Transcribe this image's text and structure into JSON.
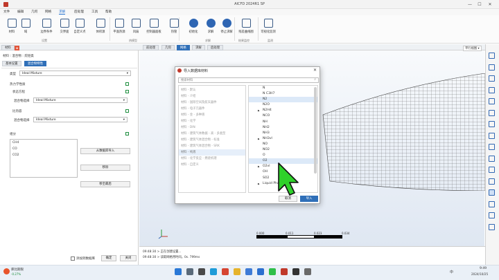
{
  "window": {
    "title": "AICFD 2024R1 SP",
    "min": "—",
    "max": "☐",
    "close": "✕"
  },
  "menu": [
    "文件",
    "编辑",
    "几何",
    "网格",
    "求解",
    "后处理",
    "工具",
    "帮助"
  ],
  "menu_active_index": 4,
  "ribbon": {
    "buttons": [
      {
        "label": "材料",
        "icon": "materials-icon"
      },
      {
        "label": "域",
        "icon": "domain-icon"
      },
      {
        "label": "边界条件",
        "icon": "boundary-icon"
      },
      {
        "label": "交界面",
        "icon": "interface-icon"
      },
      {
        "label": "自定义点",
        "icon": "more-icon"
      },
      {
        "label": "体积源",
        "icon": "volume-source-icon"
      },
      {
        "label": "平面热源",
        "icon": "plane-heat-icon"
      },
      {
        "label": "风扇",
        "icon": "fan-icon"
      },
      {
        "label": "控制器面板",
        "icon": "controller-icon"
      },
      {
        "label": "热管",
        "icon": "heat-pipe-icon"
      },
      {
        "label": "初始化",
        "icon": "init-icon"
      },
      {
        "label": "求解",
        "icon": "solve-icon"
      },
      {
        "label": "停止求解",
        "icon": "stop-icon"
      },
      {
        "label": "残差曲线图",
        "icon": "residual-icon"
      },
      {
        "label": "可视化监测",
        "icon": "monitor-icon"
      }
    ],
    "groups": [
      "设置",
      "热模型",
      "求解",
      "结果监控",
      "监测"
    ]
  },
  "tabs": [
    "前处理",
    "几何",
    "网格",
    "求解",
    "后处理"
  ],
  "active_tab_index": 3,
  "left_panel": {
    "panel_tabs": [
      "材料",
      "⊠"
    ],
    "breadcrumb": "材料 : 混合物 : 烷烃类",
    "sub_tabs": [
      "基本设置",
      "混合物特性"
    ],
    "active_sub_tab": 1,
    "type_label": "类型",
    "type_value": "Ideal Mixture",
    "thermo_section": "热力学性质",
    "state_eq_label": "状态方程",
    "mix_select_label": "混合物选择",
    "state_eq_value": "Ideal Mixture",
    "specific_heat_label": "比热容",
    "specific_heat_value": "Ideal Mixture",
    "components_label": "组分",
    "components": [
      "CH4",
      "CO",
      "CO2"
    ],
    "btn_import_db": "从数据库导入",
    "btn_remove": "移除",
    "btn_move_last": "移至最后",
    "checkbox_label": "添加到数据库",
    "btn_confirm": "确定",
    "btn_close": "关闭"
  },
  "dialog": {
    "title": "导入数据库材料",
    "search_placeholder": "搜索材料",
    "categories": [
      "材料 - 默认",
      "材料 - 介绍",
      "材料 - 国际空间及航天器件",
      "材料 - 电子元器件",
      "材料 - 金 - 多种液",
      "材料 - 化学",
      "材料 - DIN",
      "材料 - 建筑气体数据 - 高 - 多类型",
      "材料 - 建筑气体混合物 - 标准",
      "材料 - 建筑气体混合物 - SRK",
      "材料 - 纯液",
      "材料 - 化学反应 - 燃烧机理",
      "材料 - 自定义"
    ],
    "selected_category_index": 10,
    "materials": [
      {
        "name": "N",
        "arrow": false
      },
      {
        "name": "N C3H7",
        "arrow": false
      },
      {
        "name": "N2",
        "arrow": false,
        "sel": true
      },
      {
        "name": "N2O",
        "arrow": false
      },
      {
        "name": "N2H4",
        "arrow": true
      },
      {
        "name": "NCO",
        "arrow": false
      },
      {
        "name": "NH",
        "arrow": false
      },
      {
        "name": "NH2",
        "arrow": false
      },
      {
        "name": "NH3",
        "arrow": false
      },
      {
        "name": "NH3vl",
        "arrow": true
      },
      {
        "name": "NO",
        "arrow": false
      },
      {
        "name": "NO2",
        "arrow": false
      },
      {
        "name": "O",
        "arrow": false
      },
      {
        "name": "O2",
        "arrow": false,
        "sel": true
      },
      {
        "name": "O2vl",
        "arrow": true
      },
      {
        "name": "OH",
        "arrow": false
      },
      {
        "name": "SO2",
        "arrow": false
      },
      {
        "name": "Liquid Phase",
        "arrow": true
      }
    ],
    "btn_cancel": "取消",
    "btn_import": "导入"
  },
  "viewport": {
    "scale_labels": [
      "0.000",
      "0.011",
      "0.023",
      "0.034"
    ]
  },
  "console": {
    "lines": [
      "09:48:30 > 正在创建设置...",
      "09:48:30 > 读取网格用时间。0s. 799ms"
    ]
  },
  "taskbar": {
    "weather": "库比期限",
    "weather_sub": "-0.27%",
    "tray": "中",
    "time": "9:49",
    "date": "2024/10/25"
  },
  "colors": {
    "accent": "#2f6fb8",
    "cursor": "#2fd12a",
    "mesh": "#555555"
  }
}
